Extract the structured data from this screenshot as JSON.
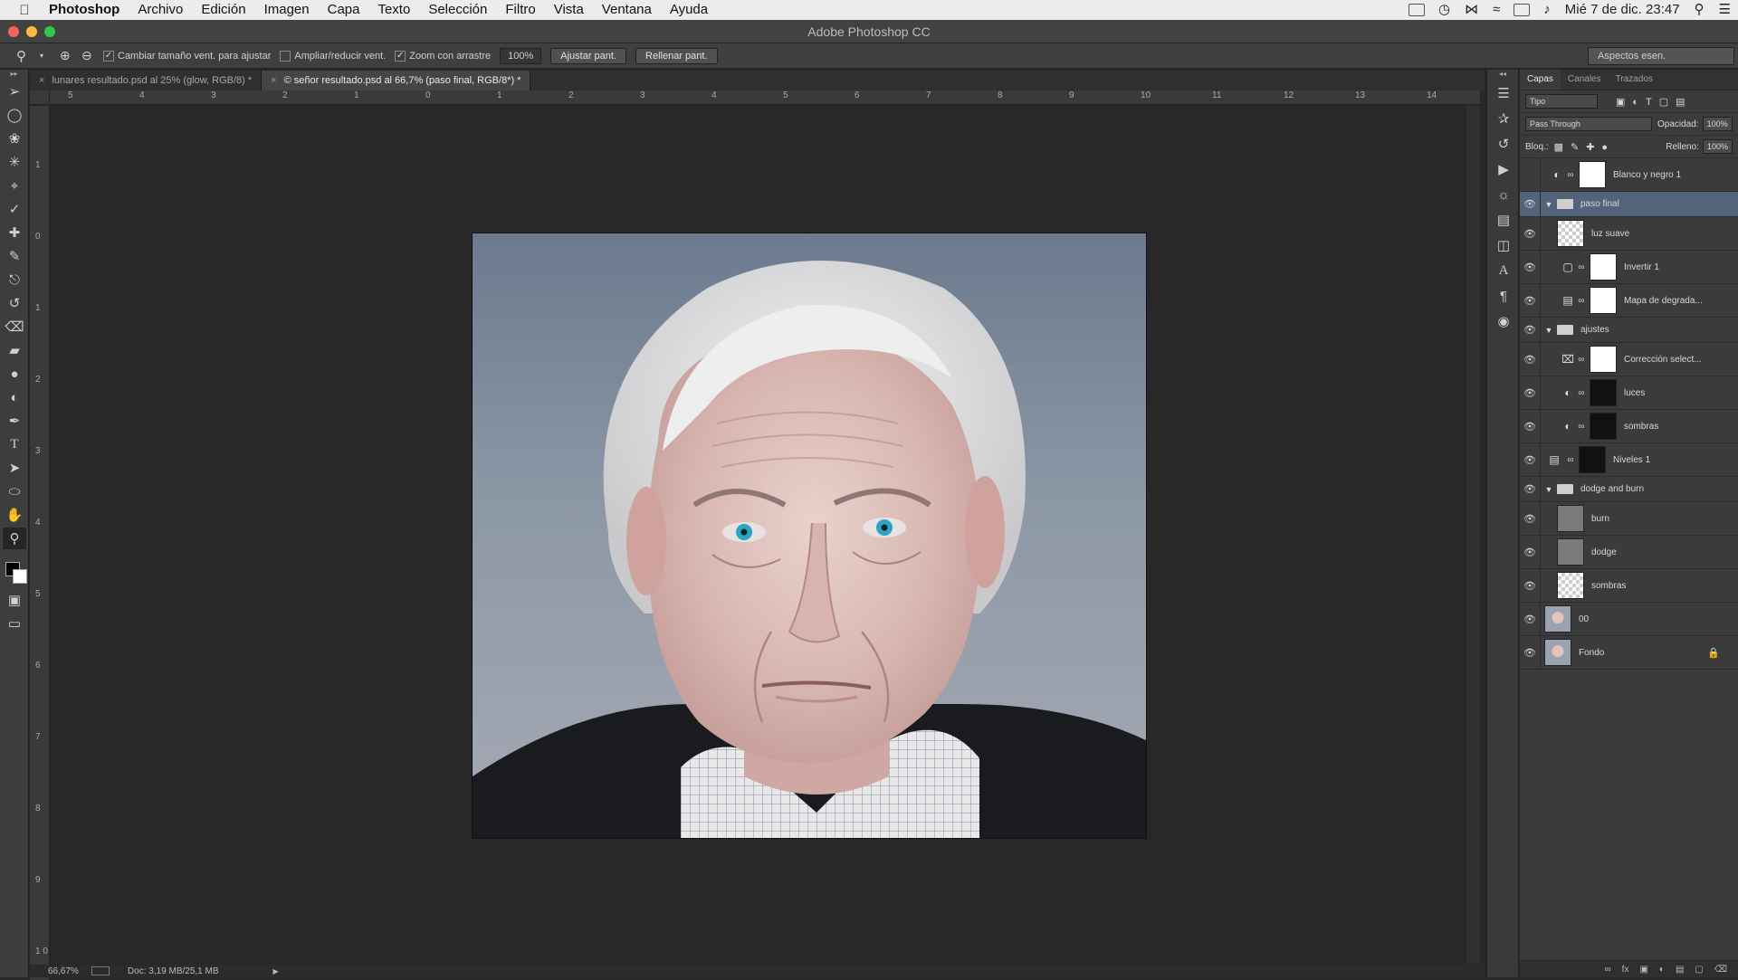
{
  "menubar": {
    "apple_icon": "apple-icon",
    "items": [
      "Photoshop",
      "Archivo",
      "Edición",
      "Imagen",
      "Capa",
      "Texto",
      "Selección",
      "Filtro",
      "Vista",
      "Ventana",
      "Ayuda"
    ],
    "datetime": "Mié 7 de dic. 23:47"
  },
  "titlebar": {
    "title": "Adobe Photoshop CC"
  },
  "options_bar": {
    "resize_windows": "Cambiar tamaño vent. para ajustar",
    "zoom_all_windows": "Ampliar/reducir vent.",
    "scrubby_zoom": "Zoom con arrastre",
    "zoom_value": "100%",
    "fit_screen": "Ajustar pant.",
    "fill_screen": "Rellenar pant.",
    "workspace": "Aspectos esen."
  },
  "tabs": [
    {
      "label": "lunares resultado.psd al 25% (glow, RGB/8) *",
      "active": false
    },
    {
      "label": "© señor resultado.psd al 66,7% (paso final, RGB/8*) *",
      "active": true
    }
  ],
  "ruler": {
    "h_ticks": [
      "5",
      "4",
      "3",
      "2",
      "1",
      "0",
      "1",
      "2",
      "3",
      "4",
      "5",
      "6",
      "7",
      "8",
      "9",
      "10",
      "11",
      "12",
      "13",
      "14"
    ],
    "v_ticks": [
      "1",
      "0",
      "1",
      "2",
      "3",
      "4",
      "5",
      "6",
      "7",
      "8",
      "9",
      "1 0"
    ]
  },
  "status": {
    "zoom": "66,67%",
    "doc": "Doc: 3,19 MB/25,1 MB"
  },
  "layers_panel": {
    "tabs": [
      "Capas",
      "Canales",
      "Trazados"
    ],
    "filter_kind": "Tipo",
    "blend_mode": "Pass Through",
    "opacity_label": "Opacidad:",
    "opacity_value": "100%",
    "lock_label": "Bloq.:",
    "fill_label": "Relleno:",
    "fill_value": "100%",
    "layers": [
      {
        "name": "Blanco y negro 1"
      },
      {
        "name": "paso final"
      },
      {
        "name": "luz suave"
      },
      {
        "name": "Invertir 1"
      },
      {
        "name": "Mapa de degrada..."
      },
      {
        "name": "ajustes"
      },
      {
        "name": "Corrección select..."
      },
      {
        "name": "luces"
      },
      {
        "name": "sombras"
      },
      {
        "name": "Niveles 1"
      },
      {
        "name": "dodge and burn"
      },
      {
        "name": "burn"
      },
      {
        "name": "dodge"
      },
      {
        "name": "sombras"
      },
      {
        "name": "00"
      },
      {
        "name": "Fondo"
      }
    ]
  }
}
